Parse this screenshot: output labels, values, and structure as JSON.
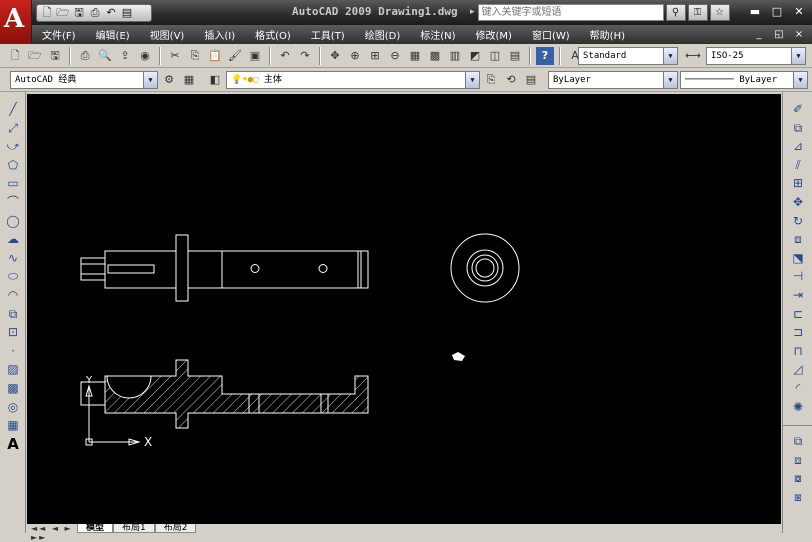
{
  "app": {
    "logo_letter": "A",
    "window_title": "AutoCAD 2009 Drawing1.dwg",
    "search_placeholder": "键入关键字或短语"
  },
  "quick_access": {
    "icons": [
      "new-icon",
      "open-icon",
      "save-icon",
      "print-icon",
      "undo-icon",
      "menu-icon"
    ]
  },
  "window_controls": {
    "minimize": "▬",
    "restore": "□",
    "close": "✕"
  },
  "menu": {
    "items": [
      "文件(F)",
      "编辑(E)",
      "视图(V)",
      "插入(I)",
      "格式(O)",
      "工具(T)",
      "绘图(D)",
      "标注(N)",
      "修改(M)",
      "窗口(W)",
      "帮助(H)"
    ],
    "doc_minimize": "_",
    "doc_restore": "◱",
    "doc_close": "×"
  },
  "toolbar": {
    "text_style": "Standard",
    "dim_style": "ISO-25",
    "workspace": "AutoCAD 经典",
    "layer": "主体",
    "color": "ByLayer",
    "linetype": "ByLayer"
  },
  "drawing": {
    "ucs_x": "X",
    "ucs_y": "Y",
    "background": "#000000",
    "line_color": "#ffffff"
  },
  "layout_tabs": {
    "nav": "◄◄ ◄ ► ►►",
    "model": "模型",
    "layout1": "布局1",
    "layout2": "布局2"
  }
}
